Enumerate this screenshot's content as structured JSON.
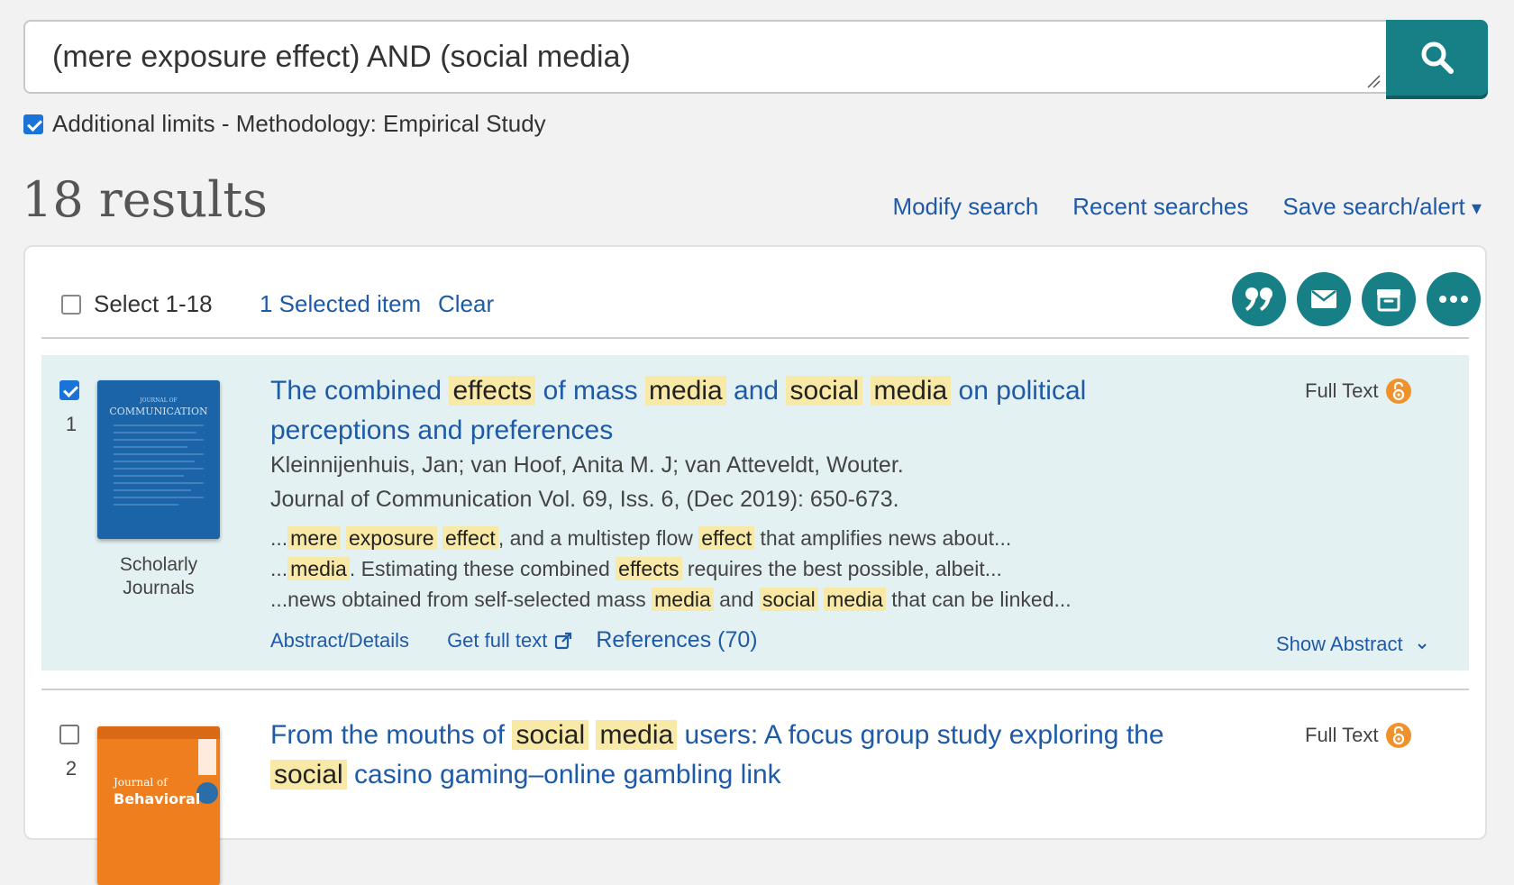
{
  "search": {
    "query": "(mere exposure effect) AND (social media)"
  },
  "limits": {
    "label": "Additional limits - Methodology: Empirical Study",
    "checked": true
  },
  "results_header": {
    "count_text": "18 results",
    "links": [
      "Modify search",
      "Recent searches",
      "Save search/alert"
    ],
    "save_arrow": "▾"
  },
  "toolbar": {
    "select_label": "Select 1-18",
    "selected_count": "1 Selected item",
    "clear_label": "Clear",
    "icons": [
      "cite-icon",
      "email-icon",
      "save-folder-icon",
      "more-icon"
    ]
  },
  "results": [
    {
      "number": "1",
      "checked": true,
      "source_type_line1": "Scholarly",
      "source_type_line2": "Journals",
      "cover_title_line1": "JOURNAL OF",
      "cover_title_line2": "COMMUNICATION",
      "title_parts": [
        {
          "t": "The combined ",
          "h": false
        },
        {
          "t": "effects",
          "h": true
        },
        {
          "t": " of mass ",
          "h": false
        },
        {
          "t": "media",
          "h": true
        },
        {
          "t": " and ",
          "h": false
        },
        {
          "t": "social",
          "h": true
        },
        {
          "t": " ",
          "h": false
        },
        {
          "t": "media",
          "h": true
        },
        {
          "t": " on political perceptions and preferences",
          "h": false
        }
      ],
      "authors": "Kleinnijenhuis, Jan; van Hoof, Anita M. J; van Atteveldt, Wouter.",
      "journal_name": "Journal of Communication",
      "journal_details": " Vol. 69, Iss. 6,  (Dec 2019): 650-673.",
      "snippets": [
        [
          {
            "t": "...",
            "h": false
          },
          {
            "t": "mere",
            "h": true
          },
          {
            "t": " ",
            "h": false
          },
          {
            "t": "exposure",
            "h": true
          },
          {
            "t": " ",
            "h": false
          },
          {
            "t": "effect",
            "h": true
          },
          {
            "t": ", and a multistep flow ",
            "h": false
          },
          {
            "t": "effect",
            "h": true
          },
          {
            "t": " that amplifies news about...",
            "h": false
          }
        ],
        [
          {
            "t": "...",
            "h": false
          },
          {
            "t": "media",
            "h": true
          },
          {
            "t": ". Estimating these combined ",
            "h": false
          },
          {
            "t": "effects",
            "h": true
          },
          {
            "t": " requires the best possible, albeit...",
            "h": false
          }
        ],
        [
          {
            "t": "...news obtained from self-selected mass ",
            "h": false
          },
          {
            "t": "media",
            "h": true
          },
          {
            "t": " and ",
            "h": false
          },
          {
            "t": "social",
            "h": true
          },
          {
            "t": " ",
            "h": false
          },
          {
            "t": "media",
            "h": true
          },
          {
            "t": " that can be linked...",
            "h": false
          }
        ]
      ],
      "abstract_link": "Abstract/Details",
      "fulltext_link": "Get full text",
      "references_link": "References (70)",
      "fulltext_label": "Full Text",
      "show_abstract": "Show Abstract"
    },
    {
      "number": "2",
      "checked": false,
      "cover_title_line1": "Journal of",
      "cover_title_line2": "Behavioral",
      "title_parts": [
        {
          "t": "From the mouths of ",
          "h": false
        },
        {
          "t": "social",
          "h": true
        },
        {
          "t": " ",
          "h": false
        },
        {
          "t": "media",
          "h": true
        },
        {
          "t": " users: A focus group study exploring the ",
          "h": false
        },
        {
          "t": "social",
          "h": true
        },
        {
          "t": " casino gaming–online gambling link",
          "h": false
        }
      ],
      "fulltext_label": "Full Text"
    }
  ],
  "colors": {
    "teal": "#177f86",
    "link": "#1f5aa6",
    "highlight": "#f9e9a7",
    "selected_bg": "#e4f1f3",
    "oa_orange": "#f0922c"
  }
}
